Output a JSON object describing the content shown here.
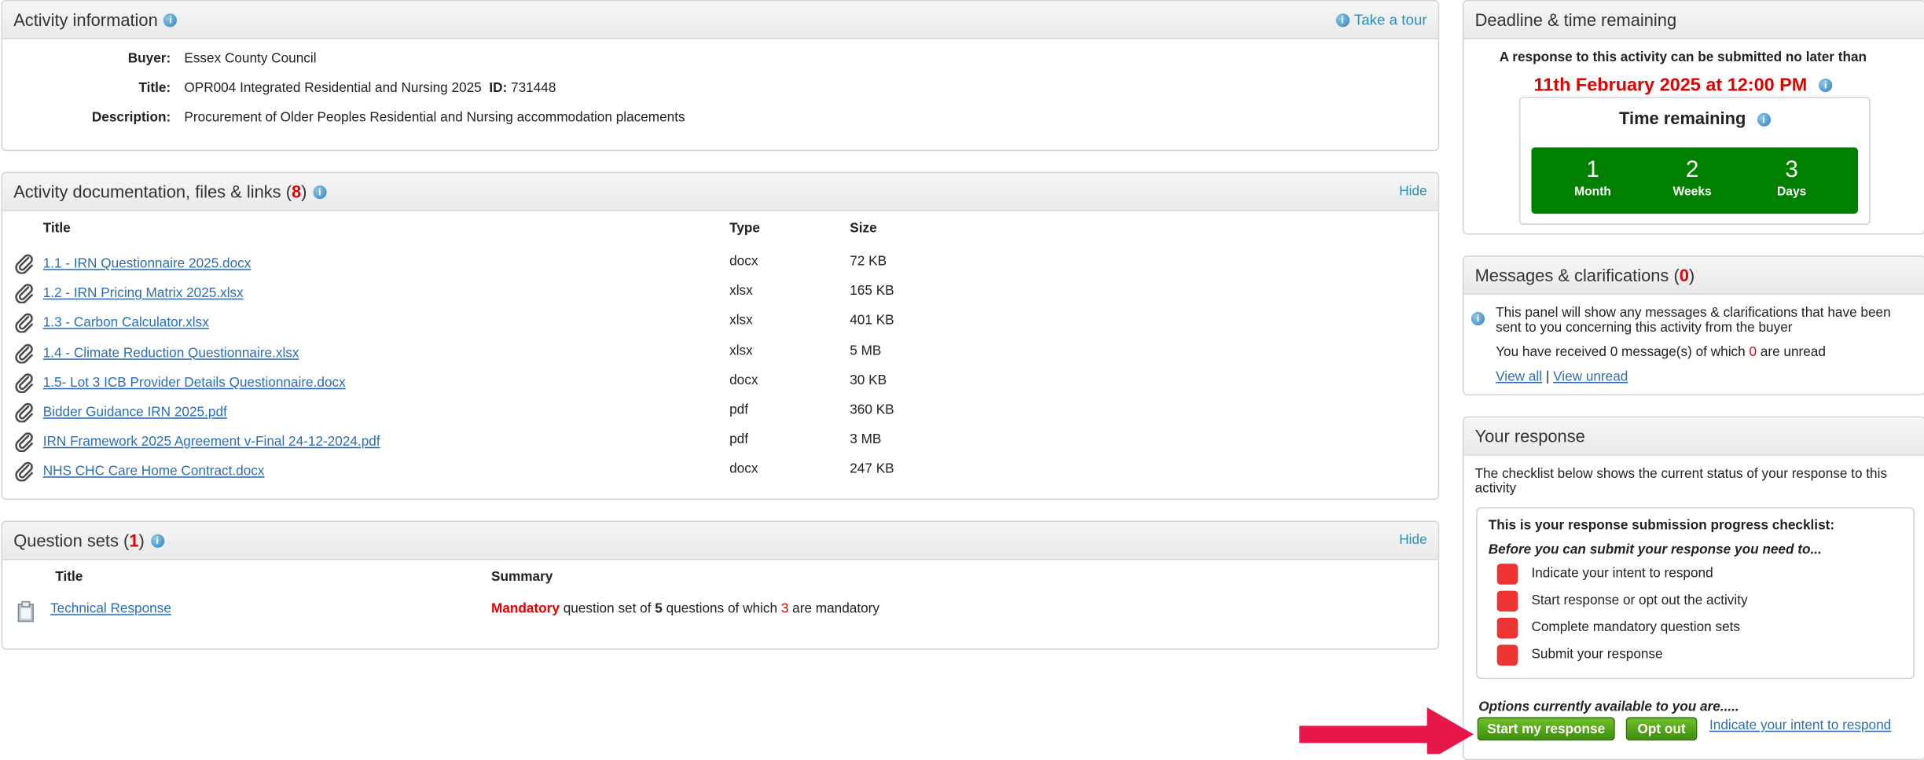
{
  "activity_info": {
    "title": "Activity information",
    "take_tour": "Take a tour",
    "buyer_label": "Buyer:",
    "buyer": "Essex County Council",
    "title_label": "Title:",
    "title_value": "OPR004 Integrated Residential and Nursing 2025",
    "id_label": "ID:",
    "id_value": "731448",
    "description_label": "Description:",
    "description": "Procurement of Older Peoples Residential and Nursing accommodation placements"
  },
  "documents": {
    "title": "Activity documentation, files & links",
    "count": "8",
    "hide": "Hide",
    "col_title": "Title",
    "col_type": "Type",
    "col_size": "Size",
    "rows": [
      {
        "title": "1.1 - IRN Questionnaire 2025.docx",
        "type": "docx",
        "size": "72 KB"
      },
      {
        "title": "1.2 - IRN Pricing Matrix 2025.xlsx",
        "type": "xlsx",
        "size": "165 KB"
      },
      {
        "title": "1.3 - Carbon Calculator.xlsx",
        "type": "xlsx",
        "size": "401 KB"
      },
      {
        "title": "1.4 - Climate Reduction Questionnaire.xlsx",
        "type": "xlsx",
        "size": "5 MB"
      },
      {
        "title": "1.5- Lot 3 ICB Provider Details Questionnaire.docx",
        "type": "docx",
        "size": "30 KB"
      },
      {
        "title": "Bidder Guidance IRN 2025.pdf",
        "type": "pdf",
        "size": "360 KB"
      },
      {
        "title": "IRN Framework 2025 Agreement v-Final 24-12-2024.pdf",
        "type": "pdf",
        "size": "3 MB"
      },
      {
        "title": "NHS CHC Care Home Contract.docx",
        "type": "docx",
        "size": "247 KB"
      }
    ]
  },
  "question_sets": {
    "title": "Question sets",
    "count": "1",
    "hide": "Hide",
    "col_title": "Title",
    "col_summary": "Summary",
    "rows": [
      {
        "title": "Technical Response",
        "mandatory": "Mandatory",
        "summary_a": " question set of ",
        "num_questions": "5",
        "summary_b": " questions of which ",
        "num_mandatory": "3",
        "summary_c": " are mandatory"
      }
    ]
  },
  "deadline": {
    "title": "Deadline & time remaining",
    "intro": "A response to this activity can be submitted no later than",
    "date": "11th February 2025 at 12:00 PM",
    "time_remaining": "Time remaining",
    "units": [
      {
        "value": "1",
        "label": "Month"
      },
      {
        "value": "2",
        "label": "Weeks"
      },
      {
        "value": "3",
        "label": "Days"
      }
    ]
  },
  "messages": {
    "title": "Messages & clarifications",
    "count": "0",
    "info": "This panel will show any messages & clarifications that have been sent to you concerning this activity from the buyer",
    "received_a": "You have received ",
    "received_count": "0",
    "received_b": " message(s) of which ",
    "unread_count": "0",
    "received_c": " are unread",
    "view_all": "View all",
    "separator": "|",
    "view_unread": "View unread"
  },
  "response": {
    "title": "Your response",
    "intro": "The checklist below shows the current status of your response to this activity",
    "checklist_title": "This is your response submission progress checklist:",
    "checklist_sub": "Before you can submit your response you need to...",
    "items": [
      "Indicate your intent to respond",
      "Start response or opt out the activity",
      "Complete mandatory question sets",
      "Submit your response"
    ],
    "options_label": "Options currently available to you are.....",
    "start_button": "Start my response",
    "opt_out_button": "Opt out",
    "intent_link": "Indicate your intent to respond"
  },
  "colors": {
    "accent_red": "#e00000",
    "timer_green": "#008000",
    "button_green": "#4f9f16",
    "status_red": "#ee3333",
    "arrow": "#e8174a",
    "link_blue": "#2a6ebb"
  }
}
